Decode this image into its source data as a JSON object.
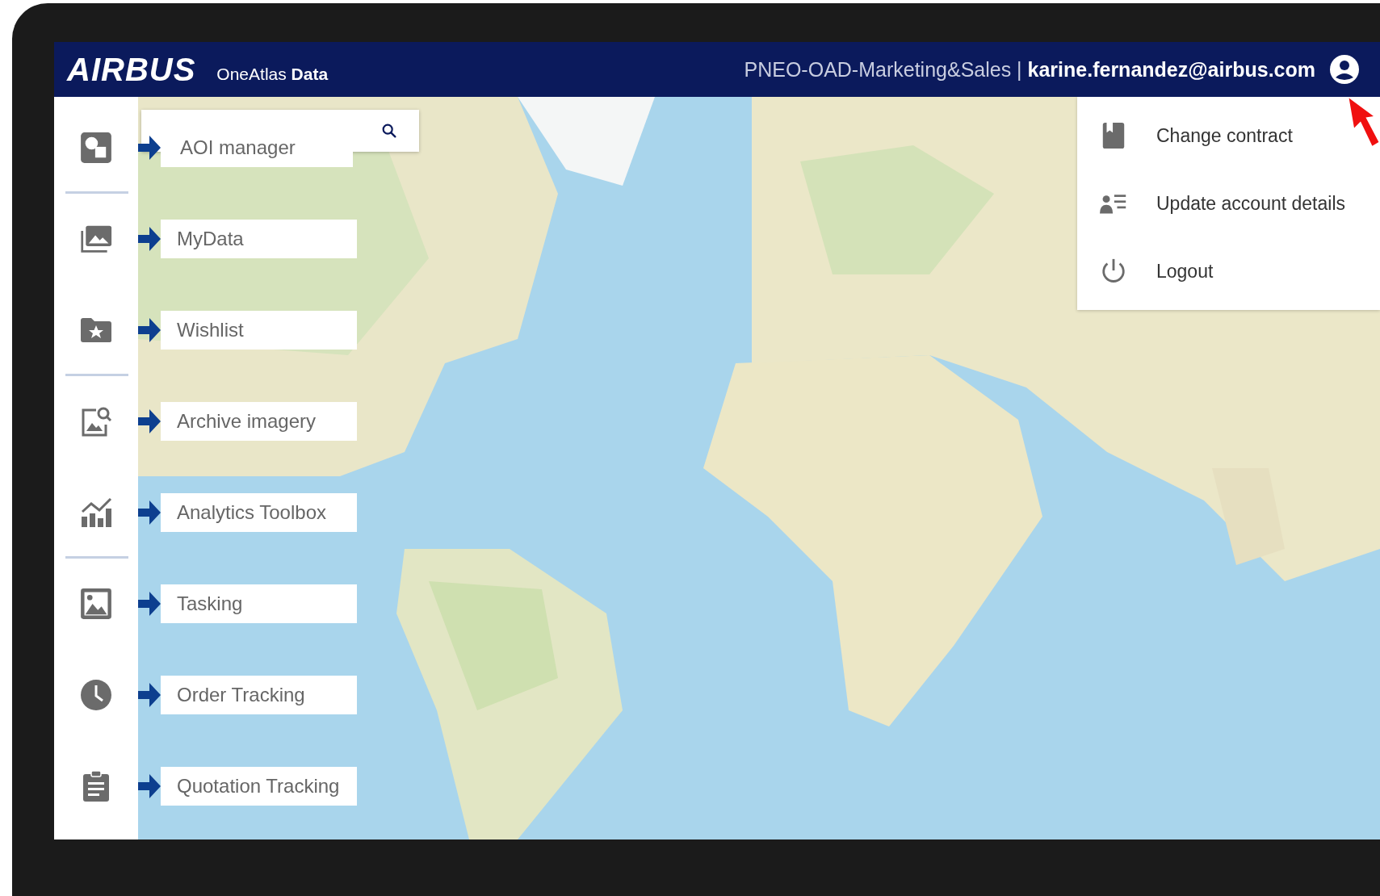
{
  "header": {
    "logo": "AIRBUS",
    "product": "OneAtlas **Data**",
    "account": "PNEO-OAD-Marketing&Sales | **karine.fernandez@airbus.com**"
  },
  "sidebar": {
    "items": [
      {
        "label": "AOI manager",
        "divider_after": true
      },
      {
        "label": "MyData",
        "divider_after": false
      },
      {
        "label": "Wishlist",
        "divider_after": true
      },
      {
        "label": "Archive imagery",
        "divider_after": false
      },
      {
        "label": "Analytics Toolbox",
        "divider_after": true
      },
      {
        "label": "Tasking",
        "divider_after": false
      },
      {
        "label": "Order Tracking",
        "divider_after": false
      },
      {
        "label": "Quotation Tracking",
        "divider_after": false
      }
    ]
  },
  "user_menu": {
    "items": [
      {
        "label": "Change contract"
      },
      {
        "label": "Update account details"
      },
      {
        "label": "Logout"
      }
    ]
  }
}
